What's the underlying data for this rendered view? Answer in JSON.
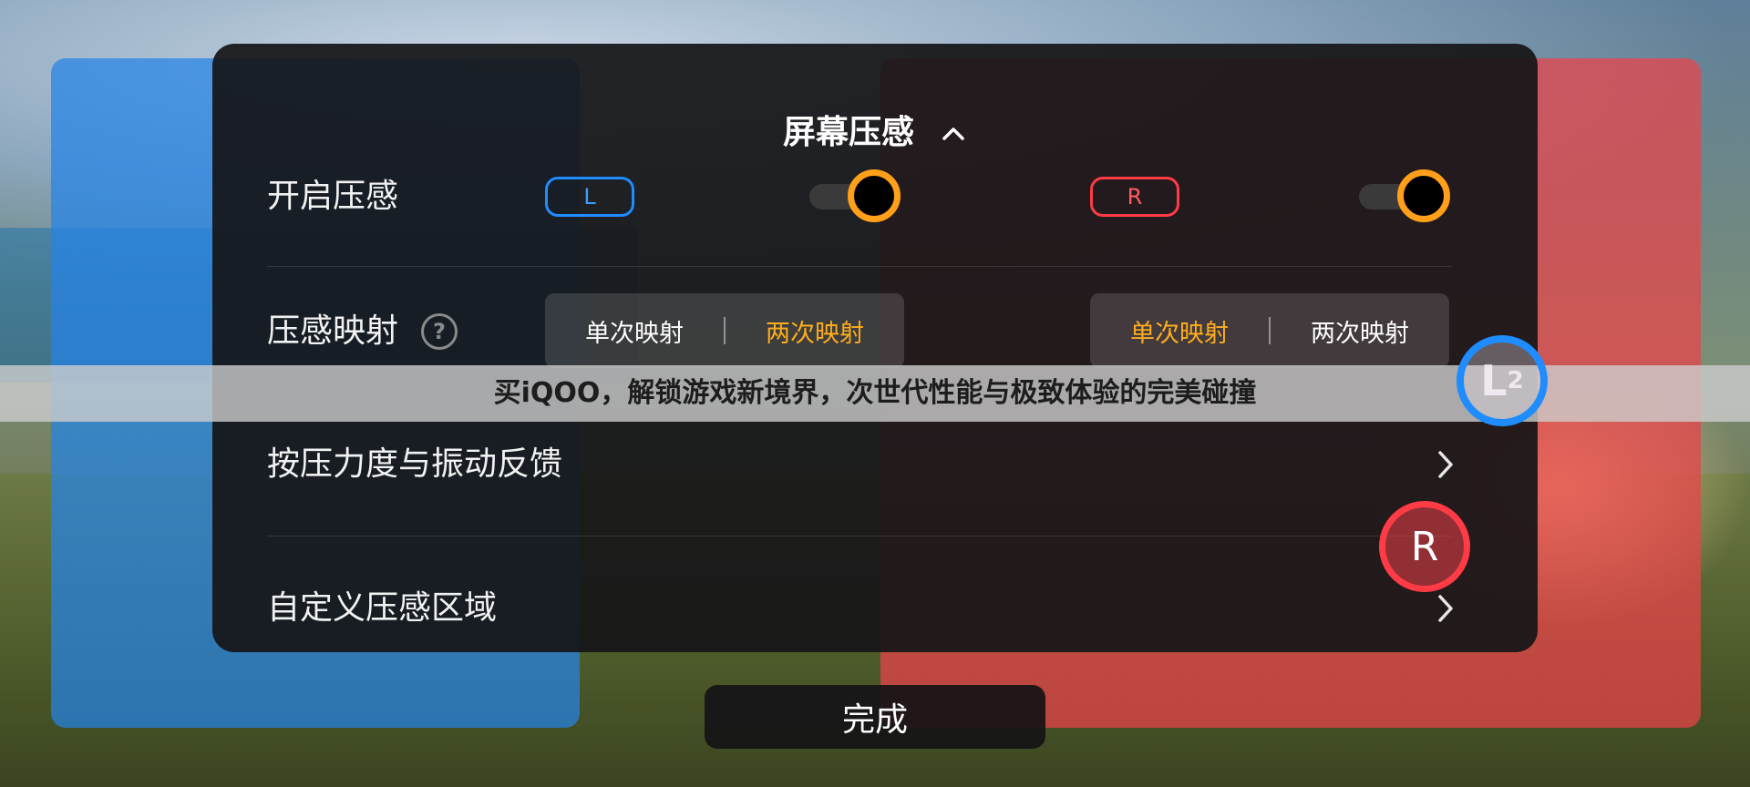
{
  "dialog": {
    "title": "屏幕压感",
    "rows": {
      "enable_pressure": "开启压感",
      "pressure_mapping": "压感映射",
      "pressure_vibration": "按压力度与振动反馈",
      "custom_area": "自定义压感区域"
    },
    "left_key_label": "L",
    "right_key_label": "R",
    "left_toggle_on": true,
    "right_toggle_on": true,
    "left_mapping": {
      "options": [
        "单次映射",
        "两次映射"
      ],
      "selected": "两次映射"
    },
    "right_mapping": {
      "options": [
        "单次映射",
        "两次映射"
      ],
      "selected": "单次映射"
    }
  },
  "banner": {
    "text": "买iQOO，解锁游戏新境界，次世代性能与极致体验的完美碰撞"
  },
  "overlay": {
    "l2_main": "L",
    "l2_sub": "2",
    "r": "R"
  },
  "footer": {
    "done_label": "完成"
  },
  "colors": {
    "accent_orange": "#ff9f1a",
    "left_blue": "#1f8cff",
    "right_red": "#ff3b45",
    "dialog_bg": "#161618"
  },
  "icons": [
    "chevron-up-icon",
    "help-icon",
    "chevron-right-icon"
  ]
}
